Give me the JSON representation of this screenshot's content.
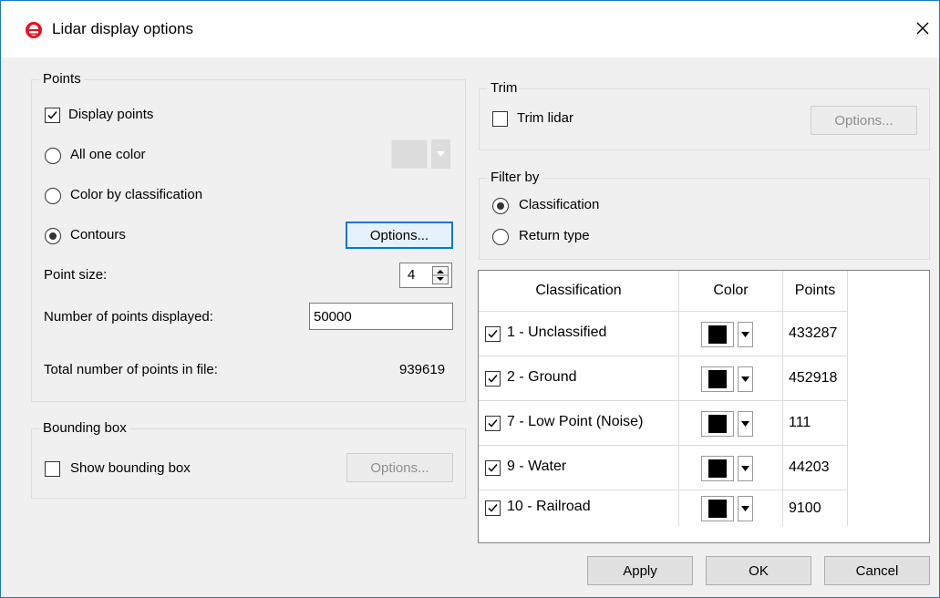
{
  "window": {
    "title": "Lidar display options"
  },
  "points": {
    "label": "Points",
    "display_points": {
      "label": "Display points",
      "checked": true
    },
    "all_one_color": {
      "label": "All one color",
      "selected": false
    },
    "color_by_classification": {
      "label": "Color by classification",
      "selected": false
    },
    "contours": {
      "label": "Contours",
      "selected": true
    },
    "options_label": "Options...",
    "point_size_label": "Point size:",
    "point_size_value": "4",
    "num_points_label": "Number of points displayed:",
    "num_points_value": "50000",
    "total_points_label": "Total number of points in file:",
    "total_points_value": "939619"
  },
  "bounding_box": {
    "label": "Bounding box",
    "show_label": "Show bounding box",
    "show_checked": false,
    "options_label": "Options..."
  },
  "trim": {
    "label": "Trim",
    "trim_label": "Trim lidar",
    "trim_checked": false,
    "options_label": "Options..."
  },
  "filter_by": {
    "label": "Filter by",
    "classification_label": "Classification",
    "return_type_label": "Return type",
    "selected": "classification"
  },
  "class_table": {
    "headers": [
      "Classification",
      "Color",
      "Points"
    ],
    "rows": [
      {
        "name": "1 - Unclassified",
        "checked": true,
        "color": "#000000",
        "points": "433287"
      },
      {
        "name": "2 - Ground",
        "checked": true,
        "color": "#000000",
        "points": "452918"
      },
      {
        "name": "7 - Low Point (Noise)",
        "checked": true,
        "color": "#000000",
        "points": "111"
      },
      {
        "name": "9 - Water",
        "checked": true,
        "color": "#000000",
        "points": "44203"
      },
      {
        "name": "10 - Railroad",
        "checked": true,
        "color": "#000000",
        "points": "9100"
      }
    ]
  },
  "footer": {
    "apply": "Apply",
    "ok": "OK",
    "cancel": "Cancel"
  },
  "colors": {
    "accent": "#0078d7",
    "app_icon": "#e81123"
  }
}
